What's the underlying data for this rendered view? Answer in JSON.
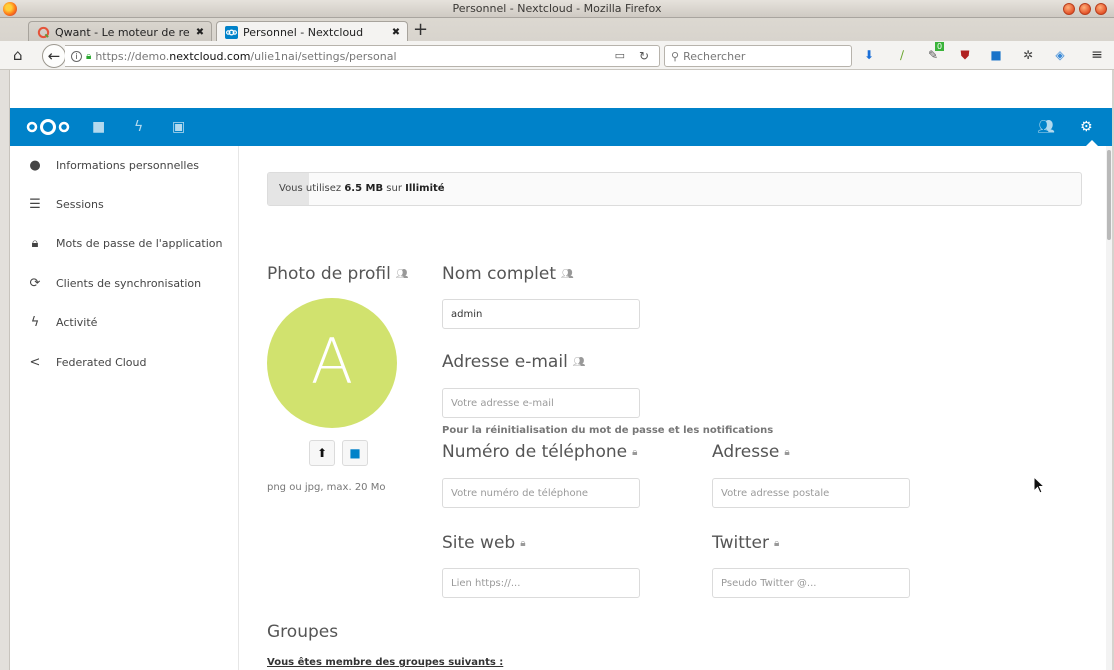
{
  "window": {
    "title": "Personnel - Nextcloud - Mozilla Firefox"
  },
  "tabs": [
    {
      "label": "Qwant - Le moteur de re",
      "close": "✖",
      "active": false
    },
    {
      "label": "Personnel - Nextcloud",
      "close": "✖",
      "active": true
    }
  ],
  "nav": {
    "url_prefix": "https://demo.",
    "url_domain": "nextcloud.com",
    "url_path": "/ulie1nai/settings/personal",
    "search_placeholder": "Rechercher",
    "addon_badge": "0"
  },
  "sidebar": {
    "items": [
      {
        "label": "Informations personnelles",
        "icon": "user-icon"
      },
      {
        "label": "Sessions",
        "icon": "list-icon"
      },
      {
        "label": "Mots de passe de l'application",
        "icon": "lock-icon"
      },
      {
        "label": "Clients de synchronisation",
        "icon": "sync-icon"
      },
      {
        "label": "Activité",
        "icon": "activity-icon"
      },
      {
        "label": "Federated Cloud",
        "icon": "share-icon"
      }
    ]
  },
  "quota": {
    "prefix": "Vous utilisez",
    "used": "6.5 MB",
    "middle": "sur",
    "total": "Illimité",
    "fill_fraction": 0.05
  },
  "profile": {
    "photo_title": "Photo de profil",
    "avatar_letter": "A",
    "avatar_color": "#d1e26e",
    "photo_hint": "png ou jpg, max. 20 Mo",
    "fullname_title": "Nom complet",
    "fullname_value": "admin",
    "email_title": "Adresse e-mail",
    "email_placeholder": "Votre adresse e-mail",
    "email_hint": "Pour la réinitialisation du mot de passe et les notifications",
    "phone_title": "Numéro de téléphone",
    "phone_placeholder": "Votre numéro de téléphone",
    "address_title": "Adresse",
    "address_placeholder": "Votre adresse postale",
    "website_title": "Site web",
    "website_placeholder": "Lien https://...",
    "twitter_title": "Twitter",
    "twitter_placeholder": "Pseudo Twitter @..."
  },
  "groups": {
    "title": "Groupes",
    "subtitle": "Vous êtes membre des groupes suivants :"
  },
  "colors": {
    "nextcloud_blue": "#0082c9"
  }
}
